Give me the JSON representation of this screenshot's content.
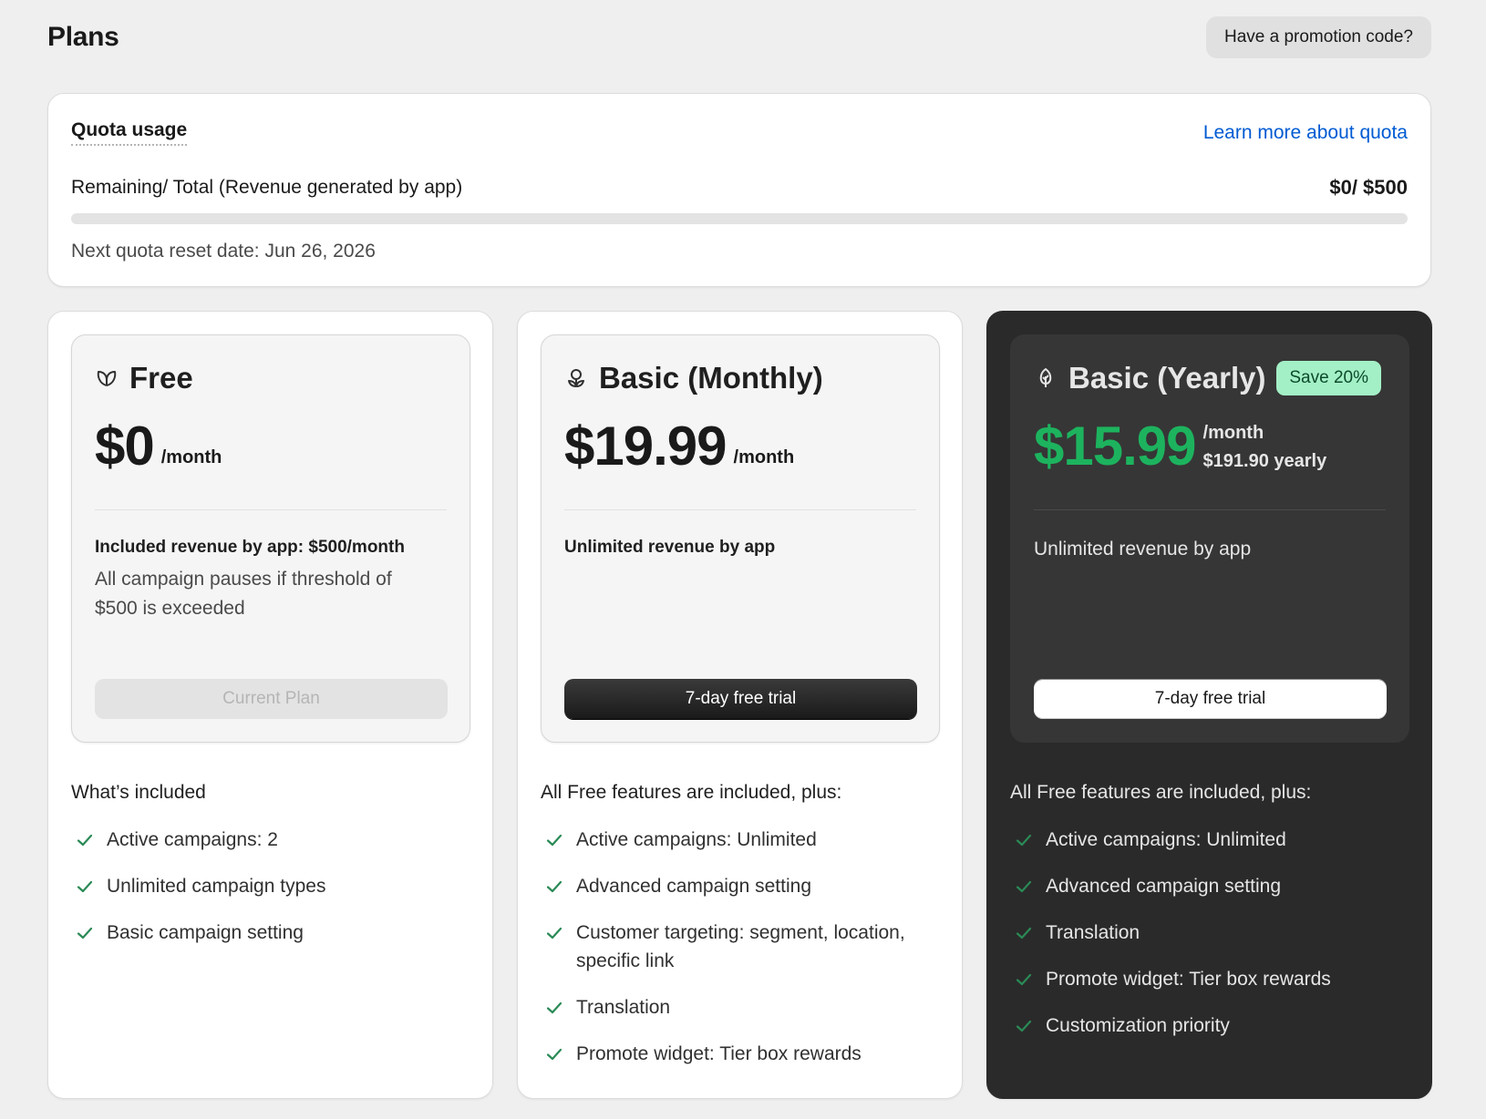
{
  "header": {
    "title": "Plans",
    "promo_button": "Have a promotion code?"
  },
  "quota": {
    "title": "Quota usage",
    "learn_more": "Learn more about quota",
    "label": "Remaining/ Total (Revenue generated by app)",
    "value": "$0/ $500",
    "progress_fraction": 0,
    "reset_text": "Next quota reset date: Jun 26, 2026"
  },
  "colors": {
    "accent_green": "#1db35e",
    "check_green": "#2a8a56",
    "badge_bg": "#a4f0c6",
    "link_blue": "#005bd3",
    "dark_card": "#2a2a2a"
  },
  "plans": [
    {
      "icon": "leaf-icon",
      "name": "Free",
      "price": "$0",
      "per": "/month",
      "revenue_title": "Included revenue by app: $500/month",
      "revenue_note": "All campaign pauses if threshold of $500 is exceeded",
      "button": "Current Plan",
      "features_heading": "What’s included",
      "features": [
        "Active campaigns: 2",
        "Unlimited campaign types",
        "Basic campaign setting"
      ]
    },
    {
      "icon": "sprout-icon",
      "name": "Basic (Monthly)",
      "price": "$19.99",
      "per": "/month",
      "revenue_title": "Unlimited revenue by app",
      "button": "7-day free trial",
      "features_heading": "All Free features are included, plus:",
      "features": [
        "Active campaigns: Unlimited",
        "Advanced campaign setting",
        "Customer targeting: segment, location, specific link",
        "Translation",
        "Promote widget: Tier box rewards"
      ]
    },
    {
      "icon": "tree-icon",
      "name": "Basic (Yearly)",
      "badge": "Save 20%",
      "price": "$15.99",
      "per": "/month",
      "per_yearly": "$191.90 yearly",
      "revenue_title": "Unlimited revenue by app",
      "button": "7-day free trial",
      "features_heading": "All Free features are included, plus:",
      "features": [
        "Active campaigns: Unlimited",
        "Advanced campaign setting",
        "Translation",
        "Promote widget: Tier box rewards",
        "Customization priority"
      ]
    }
  ]
}
